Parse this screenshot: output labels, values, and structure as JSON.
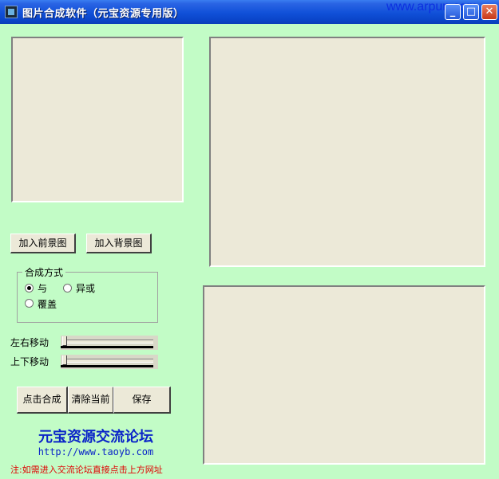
{
  "window": {
    "title": "图片合成软件（元宝资源专用版）",
    "watermark": "www.arpun.com"
  },
  "titlebar_buttons": {
    "minimize": "_",
    "maximize": "□",
    "close": "✕"
  },
  "icons": {
    "app": "app-icon",
    "minimize": "minimize-icon",
    "maximize": "maximize-icon",
    "close": "close-icon"
  },
  "buttons": {
    "add_foreground": "加入前景图",
    "add_background": "加入背景图",
    "compose": "点击合成",
    "clear_current": "清除当前",
    "save": "保存"
  },
  "mode_group": {
    "title": "合成方式",
    "options": [
      {
        "label": "与",
        "selected": true
      },
      {
        "label": "异或",
        "selected": false
      },
      {
        "label": "覆盖",
        "selected": false
      }
    ]
  },
  "sliders": {
    "horizontal": {
      "label": "左右移动",
      "value": 0
    },
    "vertical": {
      "label": "上下移动",
      "value": 0
    }
  },
  "footer": {
    "forum_name": "元宝资源交流论坛",
    "forum_url": "http://www.taoyb.com",
    "note": "注:如需进入交流论坛直接点击上方网址"
  },
  "colors": {
    "background": "#c2fcc6",
    "panel": "#ece9d8",
    "link": "#0a24c8",
    "note": "#e00000"
  }
}
